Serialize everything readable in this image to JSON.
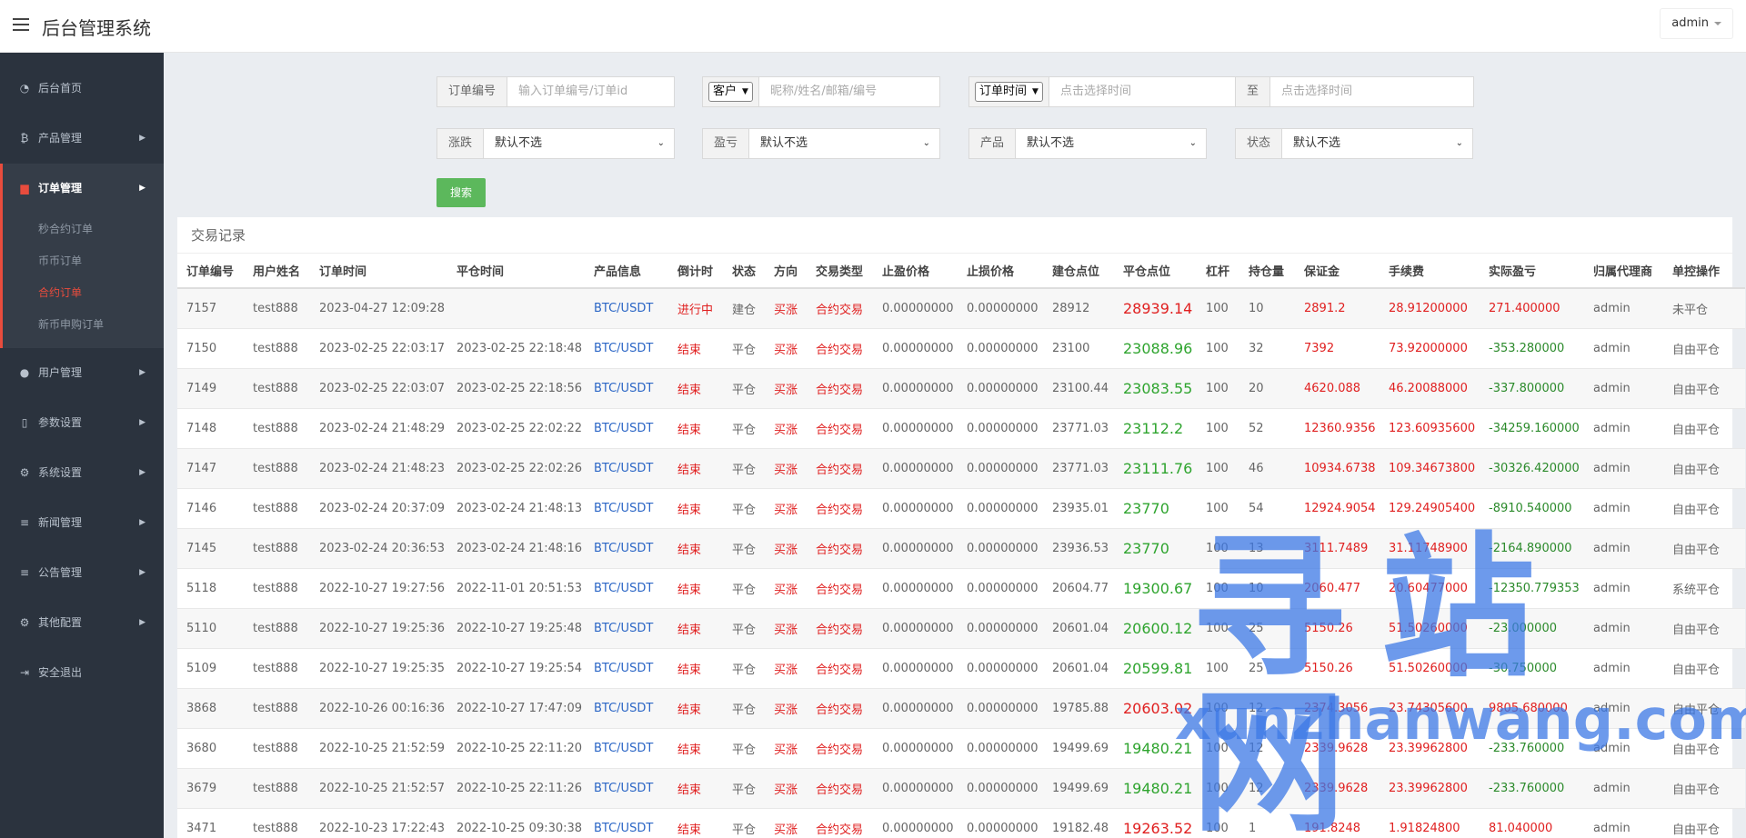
{
  "header": {
    "title": "后台管理系统",
    "user": "admin"
  },
  "sidebar": {
    "items": [
      {
        "label": "后台首页",
        "icon": "dashboard-icon",
        "glyph": "◔"
      },
      {
        "label": "产品管理",
        "icon": "bitcoin-icon",
        "glyph": "₿"
      },
      {
        "label": "订单管理",
        "icon": "order-icon",
        "glyph": "▆"
      },
      {
        "label": "用户管理",
        "icon": "user-icon",
        "glyph": "●"
      },
      {
        "label": "参数设置",
        "icon": "file-icon",
        "glyph": "▯"
      },
      {
        "label": "系统设置",
        "icon": "gears-icon",
        "glyph": "⚙"
      },
      {
        "label": "新闻管理",
        "icon": "list-icon",
        "glyph": "≡"
      },
      {
        "label": "公告管理",
        "icon": "list-icon",
        "glyph": "≡"
      },
      {
        "label": "其他配置",
        "icon": "gear-icon",
        "glyph": "⚙"
      },
      {
        "label": "安全退出",
        "icon": "logout-icon",
        "glyph": "⇥"
      }
    ],
    "sub_items": [
      "秒合约订单",
      "币币订单",
      "合约订单",
      "新币申购订单"
    ]
  },
  "filters": {
    "order_no_label": "订单编号",
    "order_no_placeholder": "输入订单编号/订单id",
    "customer_select": "客户",
    "customer_placeholder": "昵称/姓名/邮箱/编号",
    "time_select": "订单时间",
    "time_from_placeholder": "点击选择时间",
    "to_label": "至",
    "time_to_placeholder": "点击选择时间",
    "rise_fall_label": "涨跌",
    "profit_label": "盈亏",
    "product_label": "产品",
    "status_label": "状态",
    "default_option": "默认不选",
    "search_button": "搜索"
  },
  "table": {
    "title": "交易记录",
    "columns": [
      "订单编号",
      "用户姓名",
      "订单时间",
      "平仓时间",
      "产品信息",
      "倒计时",
      "状态",
      "方向",
      "交易类型",
      "止盈价格",
      "止损价格",
      "建仓点位",
      "平仓点位",
      "杠杆",
      "持仓量",
      "保证金",
      "手续费",
      "实际盈亏",
      "归属代理商",
      "单控操作"
    ],
    "rows": [
      [
        "7157",
        "test888",
        "2023-04-27 12:09:28",
        "",
        "BTC/USDT",
        "进行中",
        "建仓",
        "买涨",
        "合约交易",
        "0.00000000",
        "0.00000000",
        "28912",
        "28939.14",
        "100",
        "10",
        "2891.2",
        "28.91200000",
        "271.400000",
        "admin",
        "未平仓"
      ],
      [
        "7150",
        "test888",
        "2023-02-25 22:03:17",
        "2023-02-25 22:18:48",
        "BTC/USDT",
        "结束",
        "平仓",
        "买涨",
        "合约交易",
        "0.00000000",
        "0.00000000",
        "23100",
        "23088.96",
        "100",
        "32",
        "7392",
        "73.92000000",
        "-353.280000",
        "admin",
        "自由平仓"
      ],
      [
        "7149",
        "test888",
        "2023-02-25 22:03:07",
        "2023-02-25 22:18:56",
        "BTC/USDT",
        "结束",
        "平仓",
        "买涨",
        "合约交易",
        "0.00000000",
        "0.00000000",
        "23100.44",
        "23083.55",
        "100",
        "20",
        "4620.088",
        "46.20088000",
        "-337.800000",
        "admin",
        "自由平仓"
      ],
      [
        "7148",
        "test888",
        "2023-02-24 21:48:29",
        "2023-02-25 22:02:22",
        "BTC/USDT",
        "结束",
        "平仓",
        "买涨",
        "合约交易",
        "0.00000000",
        "0.00000000",
        "23771.03",
        "23112.2",
        "100",
        "52",
        "12360.9356",
        "123.60935600",
        "-34259.160000",
        "admin",
        "自由平仓"
      ],
      [
        "7147",
        "test888",
        "2023-02-24 21:48:23",
        "2023-02-25 22:02:26",
        "BTC/USDT",
        "结束",
        "平仓",
        "买涨",
        "合约交易",
        "0.00000000",
        "0.00000000",
        "23771.03",
        "23111.76",
        "100",
        "46",
        "10934.6738",
        "109.34673800",
        "-30326.420000",
        "admin",
        "自由平仓"
      ],
      [
        "7146",
        "test888",
        "2023-02-24 20:37:09",
        "2023-02-24 21:48:13",
        "BTC/USDT",
        "结束",
        "平仓",
        "买涨",
        "合约交易",
        "0.00000000",
        "0.00000000",
        "23935.01",
        "23770",
        "100",
        "54",
        "12924.9054",
        "129.24905400",
        "-8910.540000",
        "admin",
        "自由平仓"
      ],
      [
        "7145",
        "test888",
        "2023-02-24 20:36:53",
        "2023-02-24 21:48:16",
        "BTC/USDT",
        "结束",
        "平仓",
        "买涨",
        "合约交易",
        "0.00000000",
        "0.00000000",
        "23936.53",
        "23770",
        "100",
        "13",
        "3111.7489",
        "31.11748900",
        "-2164.890000",
        "admin",
        "自由平仓"
      ],
      [
        "5118",
        "test888",
        "2022-10-27 19:27:56",
        "2022-11-01 20:51:53",
        "BTC/USDT",
        "结束",
        "平仓",
        "买涨",
        "合约交易",
        "0.00000000",
        "0.00000000",
        "20604.77",
        "19300.67",
        "100",
        "10",
        "2060.477",
        "20.60477000",
        "-12350.779353",
        "admin",
        "系统平仓"
      ],
      [
        "5110",
        "test888",
        "2022-10-27 19:25:36",
        "2022-10-27 19:25:48",
        "BTC/USDT",
        "结束",
        "平仓",
        "买涨",
        "合约交易",
        "0.00000000",
        "0.00000000",
        "20601.04",
        "20600.12",
        "100",
        "25",
        "5150.26",
        "51.50260000",
        "-23.000000",
        "admin",
        "自由平仓"
      ],
      [
        "5109",
        "test888",
        "2022-10-27 19:25:35",
        "2022-10-27 19:25:54",
        "BTC/USDT",
        "结束",
        "平仓",
        "买涨",
        "合约交易",
        "0.00000000",
        "0.00000000",
        "20601.04",
        "20599.81",
        "100",
        "25",
        "5150.26",
        "51.50260000",
        "-30.750000",
        "admin",
        "自由平仓"
      ],
      [
        "3868",
        "test888",
        "2022-10-26 00:16:36",
        "2022-10-27 17:47:09",
        "BTC/USDT",
        "结束",
        "平仓",
        "买涨",
        "合约交易",
        "0.00000000",
        "0.00000000",
        "19785.88",
        "20603.02",
        "100",
        "12",
        "2374.3056",
        "23.74305600",
        "9805.680000",
        "admin",
        "自由平仓"
      ],
      [
        "3680",
        "test888",
        "2022-10-25 21:52:59",
        "2022-10-25 22:11:20",
        "BTC/USDT",
        "结束",
        "平仓",
        "买涨",
        "合约交易",
        "0.00000000",
        "0.00000000",
        "19499.69",
        "19480.21",
        "100",
        "12",
        "2339.9628",
        "23.39962800",
        "-233.760000",
        "admin",
        "自由平仓"
      ],
      [
        "3679",
        "test888",
        "2022-10-25 21:52:57",
        "2022-10-25 22:11:26",
        "BTC/USDT",
        "结束",
        "平仓",
        "买涨",
        "合约交易",
        "0.00000000",
        "0.00000000",
        "19499.69",
        "19480.21",
        "100",
        "12",
        "2339.9628",
        "23.39962800",
        "-233.760000",
        "admin",
        "自由平仓"
      ],
      [
        "3471",
        "test888",
        "2022-10-23 17:22:43",
        "2022-10-25 09:30:38",
        "BTC/USDT",
        "结束",
        "平仓",
        "买涨",
        "合约交易",
        "0.00000000",
        "0.00000000",
        "19182.48",
        "19263.52",
        "100",
        "1",
        "191.8248",
        "1.91824800",
        "81.040000",
        "admin",
        "自由平仓"
      ]
    ],
    "close_price_colors": [
      "red",
      "green",
      "green",
      "green",
      "green",
      "green",
      "green",
      "green",
      "green",
      "green",
      "red",
      "green",
      "green",
      "red"
    ]
  },
  "watermark": {
    "cn": "寻站网",
    "en": "xunzhanwang.com"
  },
  "colors": {
    "sidebar_bg": "#2b333e",
    "accent_red": "#e84c3d",
    "search_green": "#5cb85c",
    "link_blue": "#2b66c6",
    "loss_green": "#2b8a2b",
    "gain_red": "#e02020"
  }
}
